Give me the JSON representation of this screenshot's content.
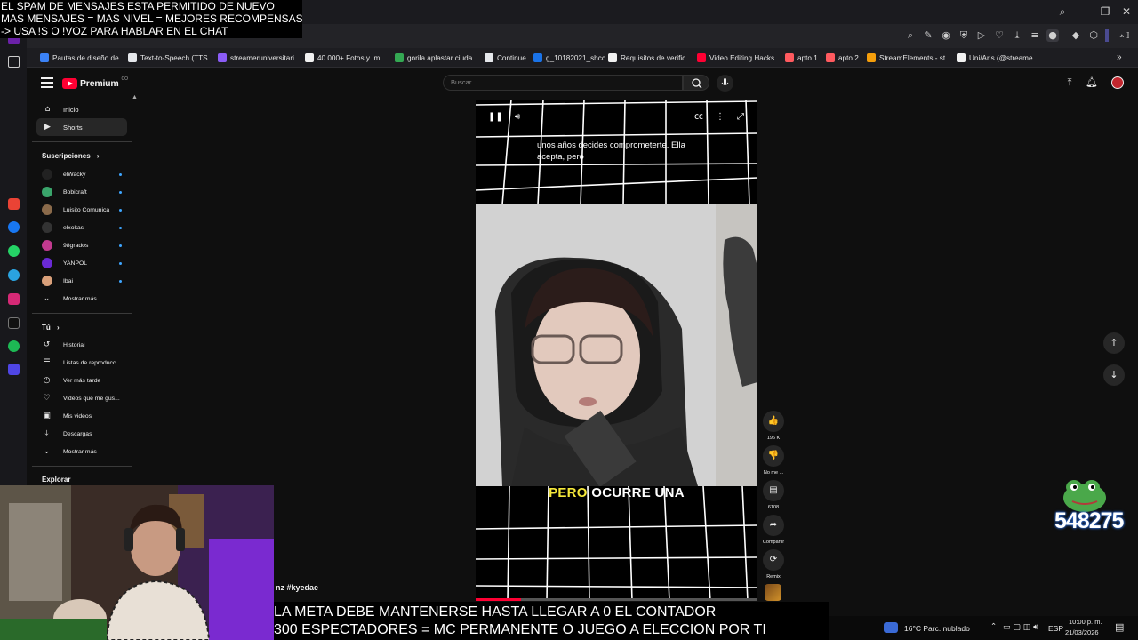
{
  "overlay_top": {
    "line1": "EL SPAM DE MENSAJES ESTA PERMITIDO DE NUEVO",
    "line2": "MAS MENSAJES = MAS NIVEL = MEJORES RECOMPENSAS",
    "line3": "-> USA !S  O !VOZ PARA HABLAR EN EL CHAT"
  },
  "bookmarks": [
    {
      "label": "Pautas de diseño de...",
      "color": "#3b82f6"
    },
    {
      "label": "Text-to-Speech (TTS...",
      "color": "#e5e7eb"
    },
    {
      "label": "streameruniversitari...",
      "color": "#8b5cf6"
    },
    {
      "label": "40.000+ Fotos y Im...",
      "color": "#f1f1f1"
    },
    {
      "label": "gorila aplastar ciuda...",
      "color": "#34a853"
    },
    {
      "label": "Continue",
      "color": "#e5e7eb"
    },
    {
      "label": "g_10182021_shcc",
      "color": "#1a73e8"
    },
    {
      "label": "Requisitos de verific...",
      "color": "#f1f1f1"
    },
    {
      "label": "Video Editing Hacks...",
      "color": "#ff0033"
    },
    {
      "label": "apto 1",
      "color": "#ff5a5f"
    },
    {
      "label": "apto 2",
      "color": "#ff5a5f"
    },
    {
      "label": "StreamElements - st...",
      "color": "#f59e0b"
    },
    {
      "label": "Uni/Aris (@streame...",
      "color": "#f1f1f1"
    }
  ],
  "youtube": {
    "brand": "Premium",
    "brand_sup": "CO",
    "search_placeholder": "Buscar",
    "nav": [
      {
        "label": "Inicio",
        "icon": "home-icon"
      },
      {
        "label": "Shorts",
        "icon": "shorts-icon"
      }
    ],
    "subscriptions_title": "Suscripciones",
    "subscriptions": [
      {
        "label": "elWacky",
        "color": "#222"
      },
      {
        "label": "Bobicraft",
        "color": "#3aa56b"
      },
      {
        "label": "Luisito Comunica",
        "color": "#8a6a4a"
      },
      {
        "label": "elxokas",
        "color": "#333"
      },
      {
        "label": "98grados",
        "color": "#c23a8f"
      },
      {
        "label": "YANPOL",
        "color": "#6a2ad6"
      },
      {
        "label": "Ibai",
        "color": "#d9a07a"
      }
    ],
    "show_more": "Mostrar más",
    "you_title": "Tú",
    "you_items": [
      {
        "label": "Historial",
        "icon": "history-icon"
      },
      {
        "label": "Listas de reproducc...",
        "icon": "playlist-icon"
      },
      {
        "label": "Ver más tarde",
        "icon": "clock-icon"
      },
      {
        "label": "Videos que me gus...",
        "icon": "like-icon"
      },
      {
        "label": "Mis videos",
        "icon": "video-icon"
      },
      {
        "label": "Descargas",
        "icon": "download-icon"
      }
    ],
    "show_more_2": "Mostrar más",
    "explore_title": "Explorar"
  },
  "video": {
    "caption_top": "unos años decides comprometerte. Ella acepta, pero",
    "caption_big_hl": "PERO",
    "caption_big_rest": "OCURRE UNA",
    "progress": 0.16,
    "hashtag": "nz #kyedae"
  },
  "actions": [
    {
      "label": "196 K",
      "icon": "thumbs-up-icon",
      "glyph": "👍"
    },
    {
      "label": "No me ...",
      "icon": "thumbs-down-icon",
      "glyph": "👎"
    },
    {
      "label": "6108",
      "icon": "comment-icon",
      "glyph": "▤"
    },
    {
      "label": "Compartir",
      "icon": "share-icon",
      "glyph": "➦"
    },
    {
      "label": "Remix",
      "icon": "remix-icon",
      "glyph": "⟳"
    }
  ],
  "widget": {
    "count": "548275"
  },
  "overlay_bottom": {
    "line1": "LA META DEBE MANTENERSE HASTA LLEGAR A 0 EL CONTADOR",
    "line2": "300 ESPECTADORES = MC PERMANENTE O JUEGO A ELECCION POR TI"
  },
  "taskbar": {
    "weather": "16°C  Parc. nublado",
    "lang": "ESP",
    "time": "10:00 p. m.",
    "date": "21/03/2026"
  },
  "colors": {
    "accent": "#ff0033",
    "caption_highlight": "#f5e83a",
    "link": "#3ea6ff"
  }
}
